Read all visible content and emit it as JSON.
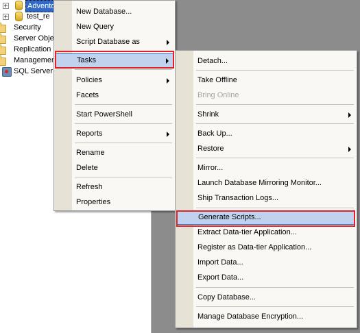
{
  "object_explorer": {
    "items": [
      {
        "label": "Advento"
      },
      {
        "label": "test_re"
      },
      {
        "label": "Security"
      },
      {
        "label": "Server Obje"
      },
      {
        "label": "Replication"
      },
      {
        "label": "Managemen"
      },
      {
        "label": "SQL Server"
      }
    ]
  },
  "context_menu": {
    "new_database": "New Database...",
    "new_query": "New Query",
    "script_database_as": "Script Database as",
    "tasks": "Tasks",
    "policies": "Policies",
    "facets": "Facets",
    "start_powershell": "Start PowerShell",
    "reports": "Reports",
    "rename": "Rename",
    "delete": "Delete",
    "refresh": "Refresh",
    "properties": "Properties"
  },
  "tasks_menu": {
    "detach": "Detach...",
    "take_offline": "Take Offline",
    "bring_online": "Bring Online",
    "shrink": "Shrink",
    "back_up": "Back Up...",
    "restore": "Restore",
    "mirror": "Mirror...",
    "launch_mirroring_monitor": "Launch Database Mirroring Monitor...",
    "ship_transaction_logs": "Ship Transaction Logs...",
    "generate_scripts": "Generate Scripts...",
    "extract_data_tier": "Extract Data-tier Application...",
    "register_data_tier": "Register as Data-tier Application...",
    "import_data": "Import Data...",
    "export_data": "Export Data...",
    "copy_database": "Copy Database...",
    "manage_encryption": "Manage Database Encryption..."
  },
  "colors": {
    "highlight_fill": "#c1d2ee",
    "highlight_border": "#316ac5",
    "annotation_red": "#e0202a",
    "disabled_text": "#a7a59c"
  }
}
